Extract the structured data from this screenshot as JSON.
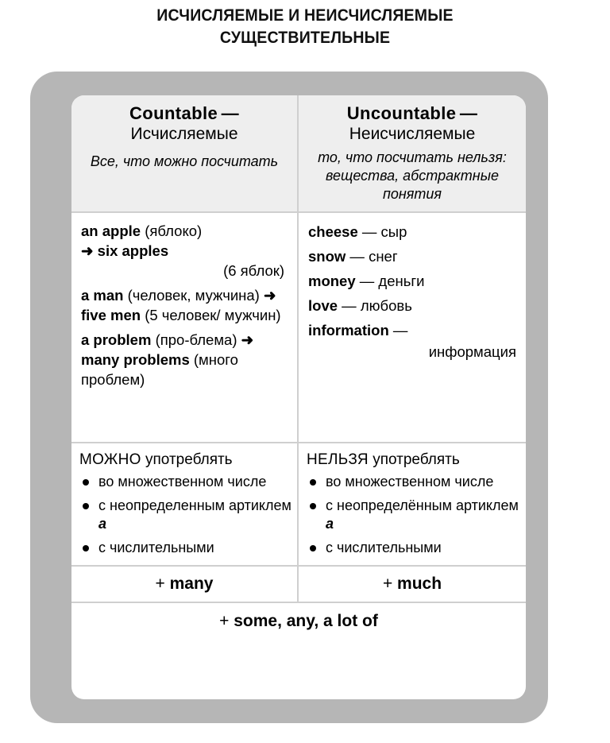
{
  "title": {
    "line1": "ИСЧИСЛЯЕМЫЕ И НЕИСЧИСЛЯЕМЫЕ",
    "line2": "СУЩЕСТВИТЕЛЬНЫЕ"
  },
  "colors": {
    "frame": "#b6b6b6",
    "card": "#ffffff",
    "header_band": "#eeeeee",
    "divider": "#cfcfcf",
    "text": "#000000"
  },
  "columns": {
    "countable": {
      "title_en": "Countable",
      "dash": "—",
      "title_ru": "Исчисляемые",
      "note": "Все, что можно посчитать",
      "examples": {
        "e1_term": "an apple",
        "e1_gloss": "(яблоко)",
        "e1_arrow": "➜",
        "e1_plural": "six apples",
        "e1_plural_gloss": "(6 яблок)",
        "e2_term": "a man",
        "e2_gloss": "(человек, мужчина)",
        "e2_arrow": "➜",
        "e2_plural": "five men",
        "e2_plural_gloss": "(5 человек/ мужчин)",
        "e3_term": "a problem",
        "e3_gloss": "(про-блема)",
        "e3_arrow": "➜",
        "e3_plural": "many problems",
        "e3_plural_gloss": "(много проблем)"
      },
      "rules_title_kw": "МОЖНО",
      "rules_title_rest": "употреблять",
      "rules": [
        "во множественном числе",
        "с неопределенным артиклем",
        "с числительными"
      ],
      "rule2_article": "a",
      "quantifier": "many"
    },
    "uncountable": {
      "title_en": "Uncountable",
      "dash": "—",
      "title_ru": "Неисчисляемые",
      "note": "то, что посчитать нельзя: вещества, абстрактные понятия",
      "examples": [
        {
          "term": "cheese",
          "dash": "—",
          "gloss": "сыр"
        },
        {
          "term": "snow",
          "dash": "—",
          "gloss": "снег"
        },
        {
          "term": "money",
          "dash": "—",
          "gloss": "деньги"
        },
        {
          "term": "love",
          "dash": "—",
          "gloss": "любовь"
        },
        {
          "term": "information",
          "dash": "—",
          "gloss": "информация"
        }
      ],
      "rules_title_kw": "НЕЛЬЗЯ",
      "rules_title_rest": "употреблять",
      "rules": [
        "во множественном числе",
        "с неопределённым артиклем",
        "с числительными"
      ],
      "rule2_article": "a",
      "quantifier": "much"
    }
  },
  "footer": {
    "plus": "+",
    "text": "some, any, a lot of"
  },
  "plus_sign": "+"
}
